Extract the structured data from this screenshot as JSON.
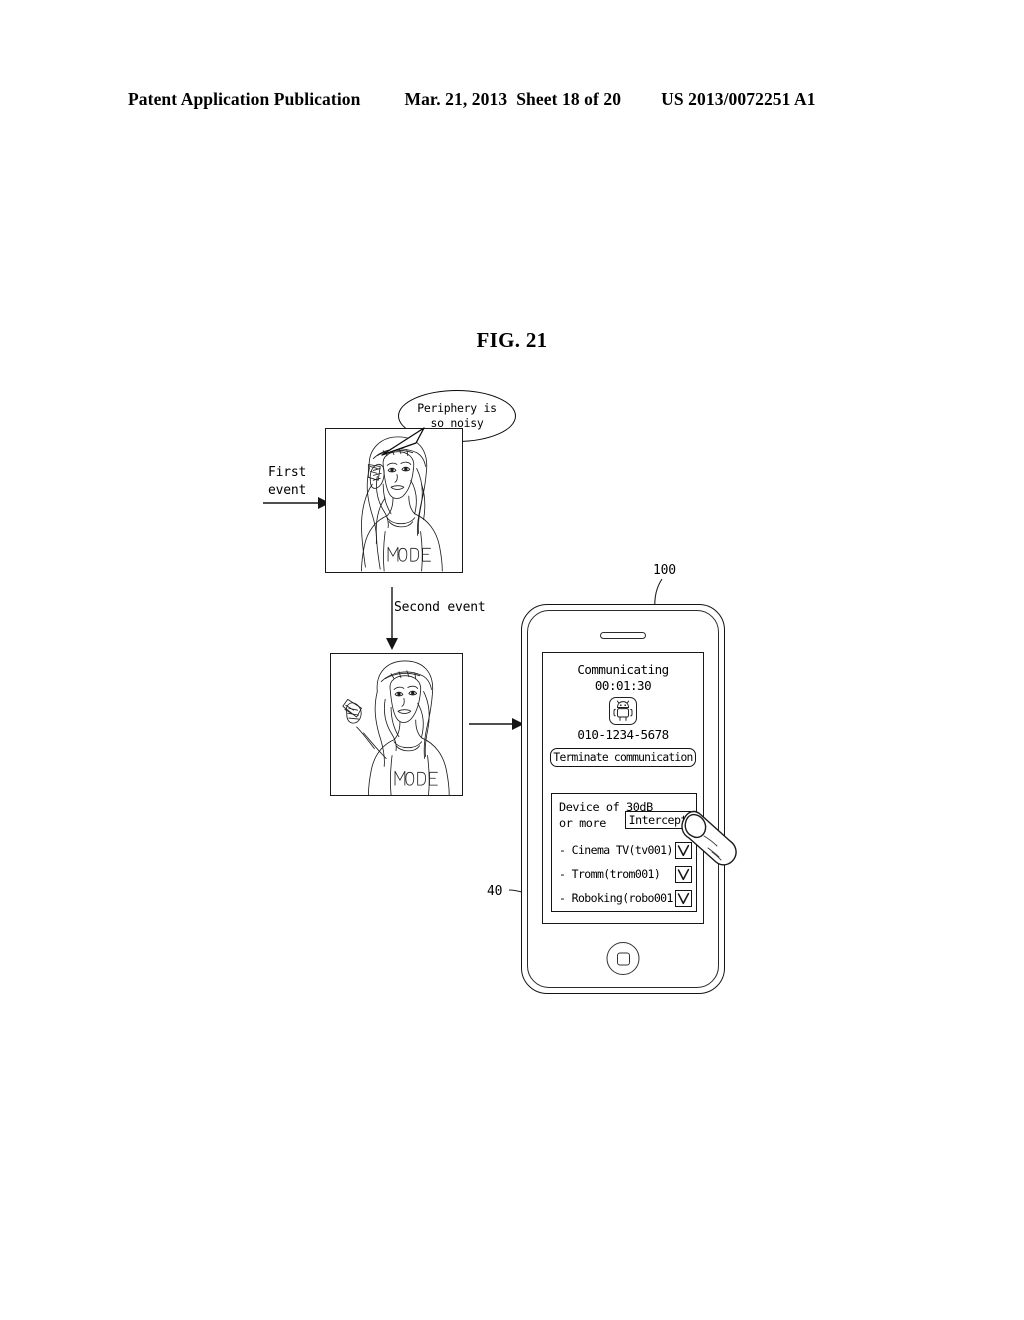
{
  "header": {
    "publication": "Patent Application Publication",
    "date": "Mar. 21, 2013",
    "sheet": "Sheet 18 of 20",
    "doc_number": "US 2013/0072251 A1"
  },
  "figure": {
    "title": "FIG. 21"
  },
  "diagram": {
    "speech_balloon": {
      "line1": "Periphery is",
      "line2": "so noisy"
    },
    "first_event_label": "First\nevent",
    "second_event_label": "Second event",
    "ref_phone": "100",
    "ref_panel": "40"
  },
  "phone": {
    "screen": {
      "call": {
        "status": "Communicating",
        "timer": "00:01:30",
        "avatar_icon": "android-robot-avatar-icon",
        "number": "010-1234-5678",
        "terminate_label": "Terminate communication"
      },
      "device_panel": {
        "heading": "Device of 30dB\nor more",
        "intercept_label": "Intercept",
        "items": [
          {
            "label": "- Cinema TV(tv001)",
            "checked": true
          },
          {
            "label": "- Tromm(trom001)",
            "checked": true
          },
          {
            "label": "- Roboking(robo001)",
            "checked": true
          }
        ]
      }
    },
    "speaker_icon": "speaker-grille-icon",
    "home_button_icon": "home-button-icon"
  }
}
